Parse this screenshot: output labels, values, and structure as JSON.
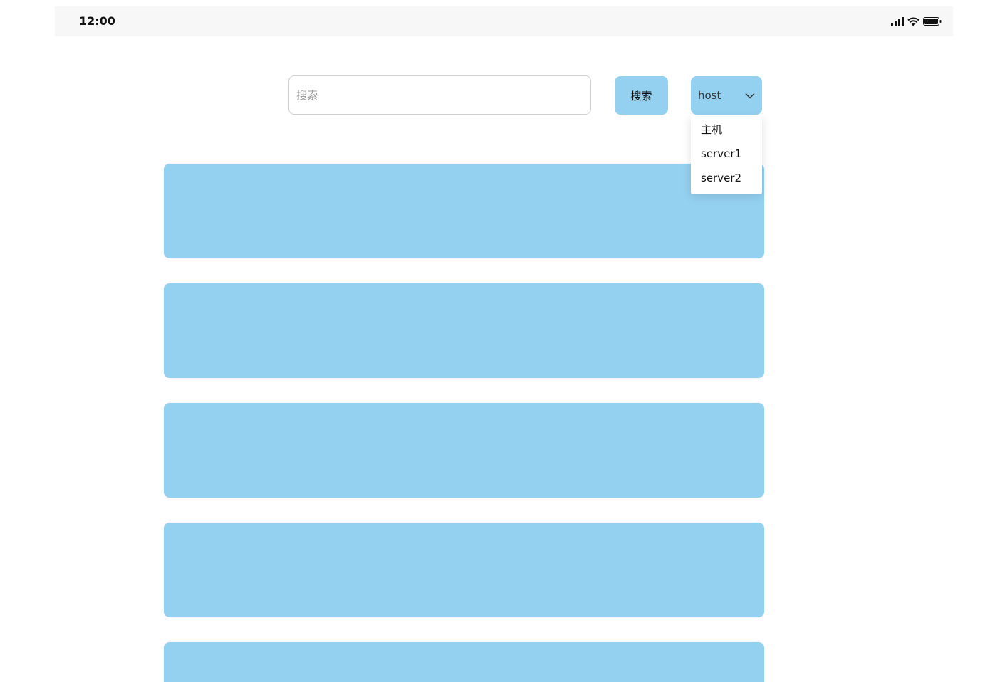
{
  "status_bar": {
    "time": "12:00",
    "icons": [
      "signal-icon",
      "wifi-icon",
      "battery-icon"
    ]
  },
  "search": {
    "placeholder": "搜索",
    "value": "",
    "button_label": "搜索"
  },
  "host_select": {
    "selected": "host",
    "options": [
      "主机",
      "server1",
      "server2"
    ]
  },
  "cards": [
    {
      "label": ""
    },
    {
      "label": ""
    },
    {
      "label": ""
    },
    {
      "label": ""
    },
    {
      "label": ""
    }
  ],
  "colors": {
    "accent": "#94d1f0",
    "status_bar_bg": "#f7f7f7"
  }
}
